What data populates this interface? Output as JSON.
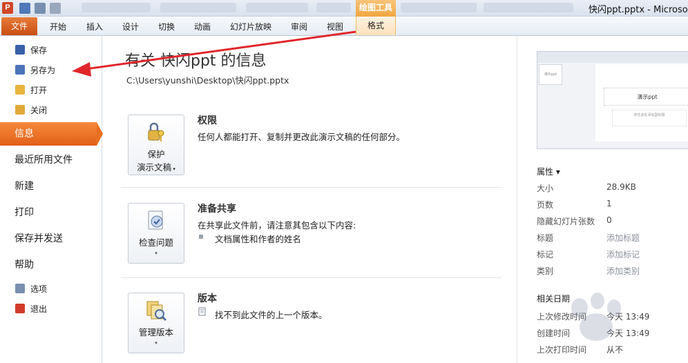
{
  "app": {
    "icon_letter": "P",
    "window_title": "快闪ppt.pptx - Microsoft"
  },
  "ribbon": {
    "contextual_group": "绘图工具",
    "tabs": [
      {
        "label": "文件"
      },
      {
        "label": "开始"
      },
      {
        "label": "插入"
      },
      {
        "label": "设计"
      },
      {
        "label": "切换"
      },
      {
        "label": "动画"
      },
      {
        "label": "幻灯片放映"
      },
      {
        "label": "审阅"
      },
      {
        "label": "视图"
      },
      {
        "label": "格式"
      }
    ]
  },
  "backstage": {
    "small_items": [
      {
        "label": "保存",
        "icon": "save-icon"
      },
      {
        "label": "另存为",
        "icon": "save-as-icon"
      },
      {
        "label": "打开",
        "icon": "open-folder-icon"
      },
      {
        "label": "关闭",
        "icon": "close-folder-icon"
      }
    ],
    "big_items": [
      {
        "label": "信息",
        "active": true
      },
      {
        "label": "最近所用文件"
      },
      {
        "label": "新建"
      },
      {
        "label": "打印"
      },
      {
        "label": "保存并发送"
      },
      {
        "label": "帮助"
      }
    ],
    "bottom_items": [
      {
        "label": "选项",
        "icon": "options-icon"
      },
      {
        "label": "退出",
        "icon": "exit-icon"
      }
    ]
  },
  "info": {
    "title": "有关 快闪ppt 的信息",
    "path": "C:\\Users\\yunshi\\Desktop\\快闪ppt.pptx",
    "sections": [
      {
        "button_line1": "保护",
        "button_line2": "演示文稿",
        "title": "权限",
        "text": "任何人都能打开、复制并更改此演示文稿的任何部分。",
        "icon": "lock-keys-icon"
      },
      {
        "button_line1": "检查问题",
        "title": "准备共享",
        "text": "在共享此文件前，请注意其包含以下内容:",
        "bullet": "文档属性和作者的姓名",
        "icon": "checklist-icon"
      },
      {
        "button_line1": "管理版本",
        "title": "版本",
        "text": "找不到此文件的上一个版本。",
        "icon": "versions-icon"
      }
    ]
  },
  "thumbnail": {
    "slide_title": "演示ppt",
    "slide_subtitle": "单击此处添加副标题",
    "left_thumb_label": "演示ppt"
  },
  "properties": {
    "header": "属性 ▾",
    "rows": [
      {
        "key": "大小",
        "value": "28.9KB",
        "placeholder": false
      },
      {
        "key": "页数",
        "value": "1",
        "placeholder": false
      },
      {
        "key": "隐藏幻灯片张数",
        "value": "0",
        "placeholder": false
      },
      {
        "key": "标题",
        "value": "添加标题",
        "placeholder": true
      },
      {
        "key": "标记",
        "value": "添加标记",
        "placeholder": true
      },
      {
        "key": "类别",
        "value": "添加类别",
        "placeholder": true
      }
    ]
  },
  "dates": {
    "header": "相关日期",
    "rows": [
      {
        "key": "上次修改时间",
        "value": "今天 13:49"
      },
      {
        "key": "创建时间",
        "value": "今天 13:49"
      },
      {
        "key": "上次打印时间",
        "value": "从不"
      }
    ]
  },
  "colors": {
    "file_tab": "#c94f13",
    "active_nav": "#e9701f",
    "annotation_arrow": "#e0262b",
    "context_tab": "#f0a640"
  }
}
